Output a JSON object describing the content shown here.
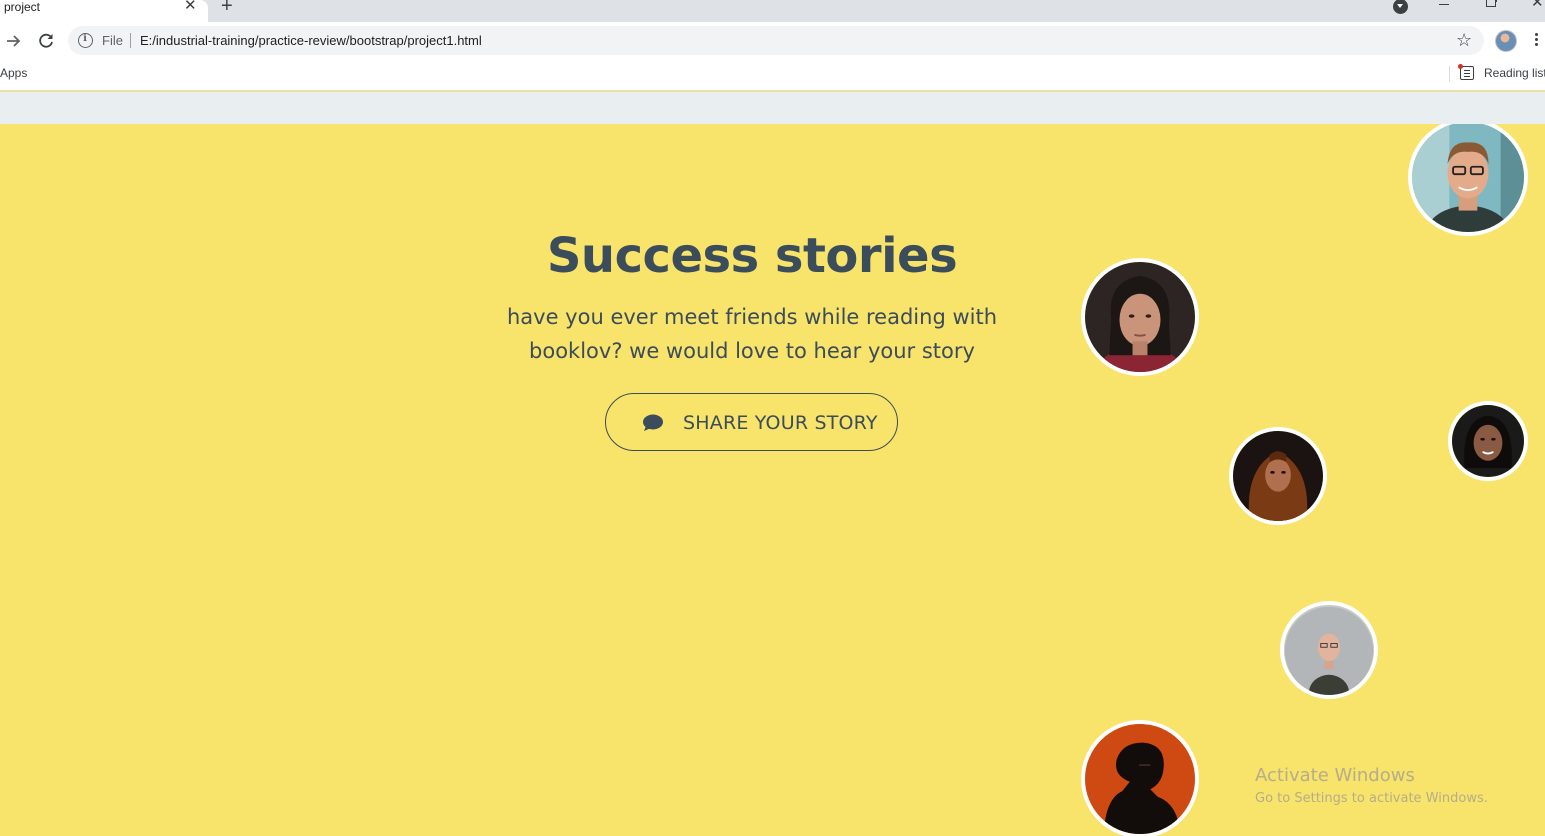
{
  "browser": {
    "tab_title": "project",
    "tab_close": "✕",
    "new_tab": "+",
    "omnibox_scheme": "File",
    "url": "E:/industrial-training/practice-review/bootstrap/project1.html",
    "bookmark_apps": "Apps",
    "reading_list": "Reading list"
  },
  "hero": {
    "title": "Success stories",
    "subtitle_line1": "have you ever meet friends while reading with",
    "subtitle_line2": "booklov? we would love to hear your story",
    "button_label": "SHARE YOUR STORY",
    "button_icon": "speech-bubble-icon"
  },
  "colors": {
    "hero_background": "#f8e36b",
    "text": "#3b4c5b",
    "nav_band": "#e9eef0"
  },
  "watermark": {
    "title": "Activate Windows",
    "subtitle": "Go to Settings to activate Windows."
  }
}
